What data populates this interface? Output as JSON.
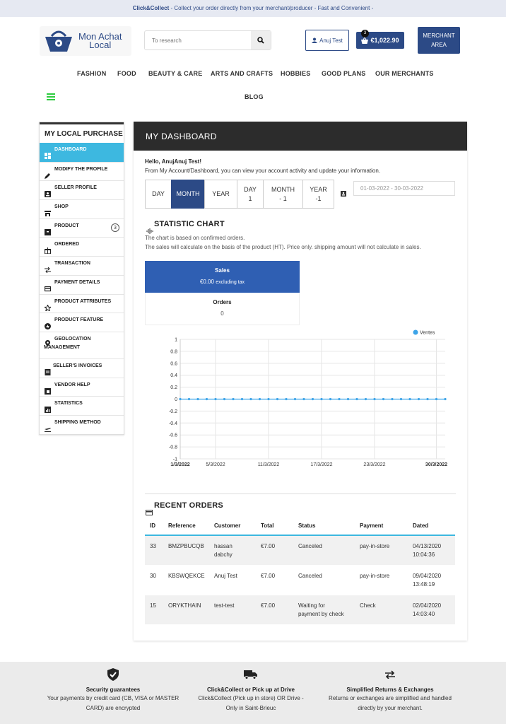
{
  "topbar": {
    "bold": "Click&Collect",
    "text": " - Collect your order directly from your merchant/producer - Fast and Convenient -"
  },
  "logo": {
    "line1": "Mon Achat",
    "line2": "Local"
  },
  "search": {
    "placeholder": "To research"
  },
  "user": {
    "name": "Anuj Test"
  },
  "cart": {
    "count": "3",
    "total": "€1,022.90"
  },
  "merchant": {
    "line1": "MERCHANT",
    "line2": "AREA"
  },
  "nav": {
    "items": [
      "FASHION",
      "FOOD",
      "BEAUTY & CARE",
      "ARTS AND CRAFTS",
      "HOBBIES",
      "GOOD PLANS",
      "OUR MERCHANTS",
      "BLOG"
    ]
  },
  "sidebar": {
    "title": "MY LOCAL PURCHASE",
    "items": [
      {
        "label": "DASHBOARD",
        "icon": "dashboard-icon"
      },
      {
        "label": "MODIFY THE PROFILE",
        "icon": "pencil-icon"
      },
      {
        "label": "SELLER PROFILE",
        "icon": "id-card-icon"
      },
      {
        "label": "SHOP",
        "icon": "store-icon"
      },
      {
        "label": "PRODUCT",
        "icon": "box-icon",
        "count": "3"
      },
      {
        "label": "ORDERED",
        "icon": "gift-icon"
      },
      {
        "label": "TRANSACTION",
        "icon": "exchange-icon"
      },
      {
        "label": "PAYMENT DETAILS",
        "icon": "credit-card-icon"
      },
      {
        "label": "PRODUCT ATTRIBUTES",
        "icon": "star-icon"
      },
      {
        "label": "PRODUCT FEATURE",
        "icon": "star-circle-icon"
      },
      {
        "label": "GEOLOCATION",
        "label2": "MANAGEMENT",
        "icon": "location-icon"
      },
      {
        "label": "SELLER'S INVOICES",
        "icon": "invoice-icon"
      },
      {
        "label": "VENDOR HELP",
        "icon": "help-icon"
      },
      {
        "label": "STATISTICS",
        "icon": "bar-chart-icon"
      },
      {
        "label": "SHIPPING METHOD",
        "icon": "plane-icon"
      }
    ]
  },
  "dashboard": {
    "title": "MY DASHBOARD",
    "hello": "Hello, AnujAnuj Test!",
    "intro": "From My Account/Dashboard, you can view your account activity and update your information.",
    "periods": [
      {
        "l1": "DAY",
        "l2": ""
      },
      {
        "l1": "MONTH",
        "l2": ""
      },
      {
        "l1": "YEAR",
        "l2": ""
      },
      {
        "l1": "DAY",
        "l2": "1"
      },
      {
        "l1": "MONTH",
        "l2": "- 1"
      },
      {
        "l1": "YEAR",
        "l2": "-1"
      }
    ],
    "active_period": 1,
    "daterange_placeholder": "01-03-2022 - 30-03-2022",
    "stat_title": "STATISTIC CHART",
    "stat_note1": "The chart is based on confirmed orders.",
    "stat_note2": "The sales will calculate on the basis of the product (HT). Price only. shipping amount will not calculate in sales.",
    "sales": {
      "title": "Sales",
      "value": "€0.00",
      "suffix": "excluding tax"
    },
    "orders": {
      "title": "Orders",
      "value": "0"
    }
  },
  "chart_data": {
    "type": "line",
    "title": "",
    "xlabel": "",
    "ylabel": "",
    "ylim": [
      -1,
      1
    ],
    "yticks": [
      "1",
      "0.8",
      "0.6",
      "0.4",
      "0.2",
      "0",
      "-0.2",
      "-0.4",
      "-0.6",
      "-0.8",
      "-1"
    ],
    "xticks": [
      "1/3/2022",
      "5/3/2022",
      "11/3/2022",
      "17/3/2022",
      "23/3/2022",
      "30/3/2022"
    ],
    "xticks_bold": [
      "1/3/2022",
      "30/3/2022"
    ],
    "x": [
      "1/3/2022",
      "2/3/2022",
      "3/3/2022",
      "4/3/2022",
      "5/3/2022",
      "6/3/2022",
      "7/3/2022",
      "8/3/2022",
      "9/3/2022",
      "10/3/2022",
      "11/3/2022",
      "12/3/2022",
      "13/3/2022",
      "14/3/2022",
      "15/3/2022",
      "16/3/2022",
      "17/3/2022",
      "18/3/2022",
      "19/3/2022",
      "20/3/2022",
      "21/3/2022",
      "22/3/2022",
      "23/3/2022",
      "24/3/2022",
      "25/3/2022",
      "26/3/2022",
      "27/3/2022",
      "28/3/2022",
      "29/3/2022",
      "30/3/2022",
      "31/3/2022"
    ],
    "series": [
      {
        "name": "Ventes",
        "color": "#3da4e8",
        "values": [
          0,
          0,
          0,
          0,
          0,
          0,
          0,
          0,
          0,
          0,
          0,
          0,
          0,
          0,
          0,
          0,
          0,
          0,
          0,
          0,
          0,
          0,
          0,
          0,
          0,
          0,
          0,
          0,
          0,
          0,
          0
        ]
      }
    ],
    "grid": true,
    "legend": "top-right"
  },
  "recent_orders": {
    "title": "RECENT ORDERS",
    "columns": [
      "ID",
      "Reference",
      "Customer",
      "Total",
      "Status",
      "Payment",
      "Dated"
    ],
    "rows": [
      {
        "id": "33",
        "ref": "BMZPBUCQB",
        "cust1": "hassan",
        "cust2": "dabchy",
        "total": "€7.00",
        "status1": "Canceled",
        "status2": "",
        "pay": "pay-in-store",
        "d1": "04/13/2020",
        "d2": "10:04:36"
      },
      {
        "id": "30",
        "ref": "KBSWQEKCE",
        "cust1": "Anuj Test",
        "cust2": "",
        "total": "€7.00",
        "status1": "Canceled",
        "status2": "",
        "pay": "pay-in-store",
        "d1": "09/04/2020",
        "d2": "13:48:19"
      },
      {
        "id": "15",
        "ref": "ORYKTHAIN",
        "cust1": "test-test",
        "cust2": "",
        "total": "€7.00",
        "status1": "Waiting for",
        "status2": "payment by check",
        "pay": "Check",
        "d1": "02/04/2020",
        "d2": "14:03:40"
      }
    ]
  },
  "footer": [
    {
      "title": "Security guarantees",
      "l1": "Your payments by credit card (CB, VISA or MASTER",
      "l2": "CARD) are encrypted",
      "icon": "shield-check-icon"
    },
    {
      "title": "Click&Collect or Pick up at Drive",
      "l1": "Click&Collect (Pick up in store) OR Drive -",
      "l2": "Only in Saint-Brieuc",
      "icon": "truck-icon"
    },
    {
      "title": "Simplified Returns & Exchanges",
      "l1": "Returns or exchanges are simplified and handled",
      "l2": "directly by your merchant.",
      "icon": "exchange-arrows-icon"
    }
  ]
}
